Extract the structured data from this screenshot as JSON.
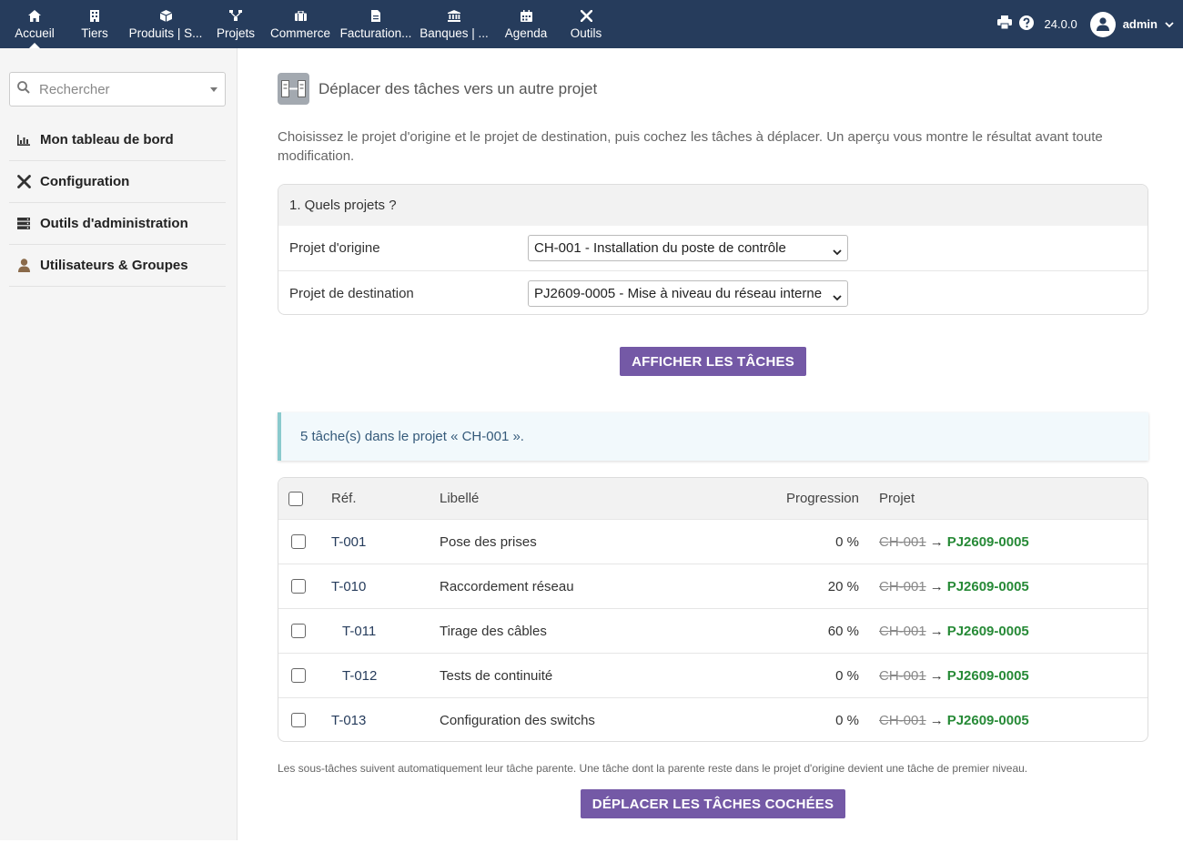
{
  "topnav": {
    "items": [
      {
        "label": "Accueil",
        "icon": "home-icon",
        "active": true
      },
      {
        "label": "Tiers",
        "icon": "building-icon"
      },
      {
        "label": "Produits | S...",
        "icon": "cube-icon"
      },
      {
        "label": "Projets",
        "icon": "sitemap-icon"
      },
      {
        "label": "Commerce",
        "icon": "briefcase-icon"
      },
      {
        "label": "Facturation...",
        "icon": "invoice-icon"
      },
      {
        "label": "Banques | ...",
        "icon": "bank-icon"
      },
      {
        "label": "Agenda",
        "icon": "calendar-icon"
      },
      {
        "label": "Outils",
        "icon": "tools-icon"
      }
    ],
    "version": "24.0.0",
    "user": "admin"
  },
  "sidebar": {
    "search_placeholder": "Rechercher",
    "items": [
      {
        "label": "Mon tableau de bord",
        "icon": "chart-icon"
      },
      {
        "label": "Configuration",
        "icon": "tools-icon"
      },
      {
        "label": "Outils d'administration",
        "icon": "server-icon"
      },
      {
        "label": "Utilisateurs & Groupes",
        "icon": "user-icon"
      }
    ]
  },
  "page": {
    "title": "Déplacer des tâches vers un autre projet",
    "intro": "Choisissez le projet d'origine et le projet de destination, puis cochez les tâches à déplacer. Un aperçu vous montre le résultat avant toute modification.",
    "step1": {
      "heading": "1. Quels projets ?",
      "origin_label": "Projet d'origine",
      "origin_value": "CH-001 - Installation du poste de contrôle",
      "dest_label": "Projet de destination",
      "dest_value": "PJ2609-0005 - Mise à niveau du réseau interne"
    },
    "show_button": "AFFICHER LES TÂCHES",
    "info_message": "5 tâche(s) dans le projet « CH-001 ».",
    "table": {
      "headers": {
        "ref": "Réf.",
        "label": "Libellé",
        "progress": "Progression",
        "project": "Projet"
      },
      "rows": [
        {
          "ref": "T-001",
          "label": "Pose des prises",
          "progress": "0 %",
          "old": "CH-001",
          "arrow": "→",
          "new": "PJ2609-0005",
          "sub": false
        },
        {
          "ref": "T-010",
          "label": "Raccordement réseau",
          "progress": "20 %",
          "old": "CH-001",
          "arrow": "→",
          "new": "PJ2609-0005",
          "sub": false
        },
        {
          "ref": "T-011",
          "label": "Tirage des câbles",
          "progress": "60 %",
          "old": "CH-001",
          "arrow": "→",
          "new": "PJ2609-0005",
          "sub": true
        },
        {
          "ref": "T-012",
          "label": "Tests de continuité",
          "progress": "0 %",
          "old": "CH-001",
          "arrow": "→",
          "new": "PJ2609-0005",
          "sub": true
        },
        {
          "ref": "T-013",
          "label": "Configuration des switchs",
          "progress": "0 %",
          "old": "CH-001",
          "arrow": "→",
          "new": "PJ2609-0005",
          "sub": false
        }
      ]
    },
    "note": "Les sous-tâches suivent automatiquement leur tâche parente. Une tâche dont la parente reste dans le projet d'origine devient une tâche de premier niveau.",
    "move_button": "DÉPLACER LES TÂCHES COCHÉES"
  }
}
